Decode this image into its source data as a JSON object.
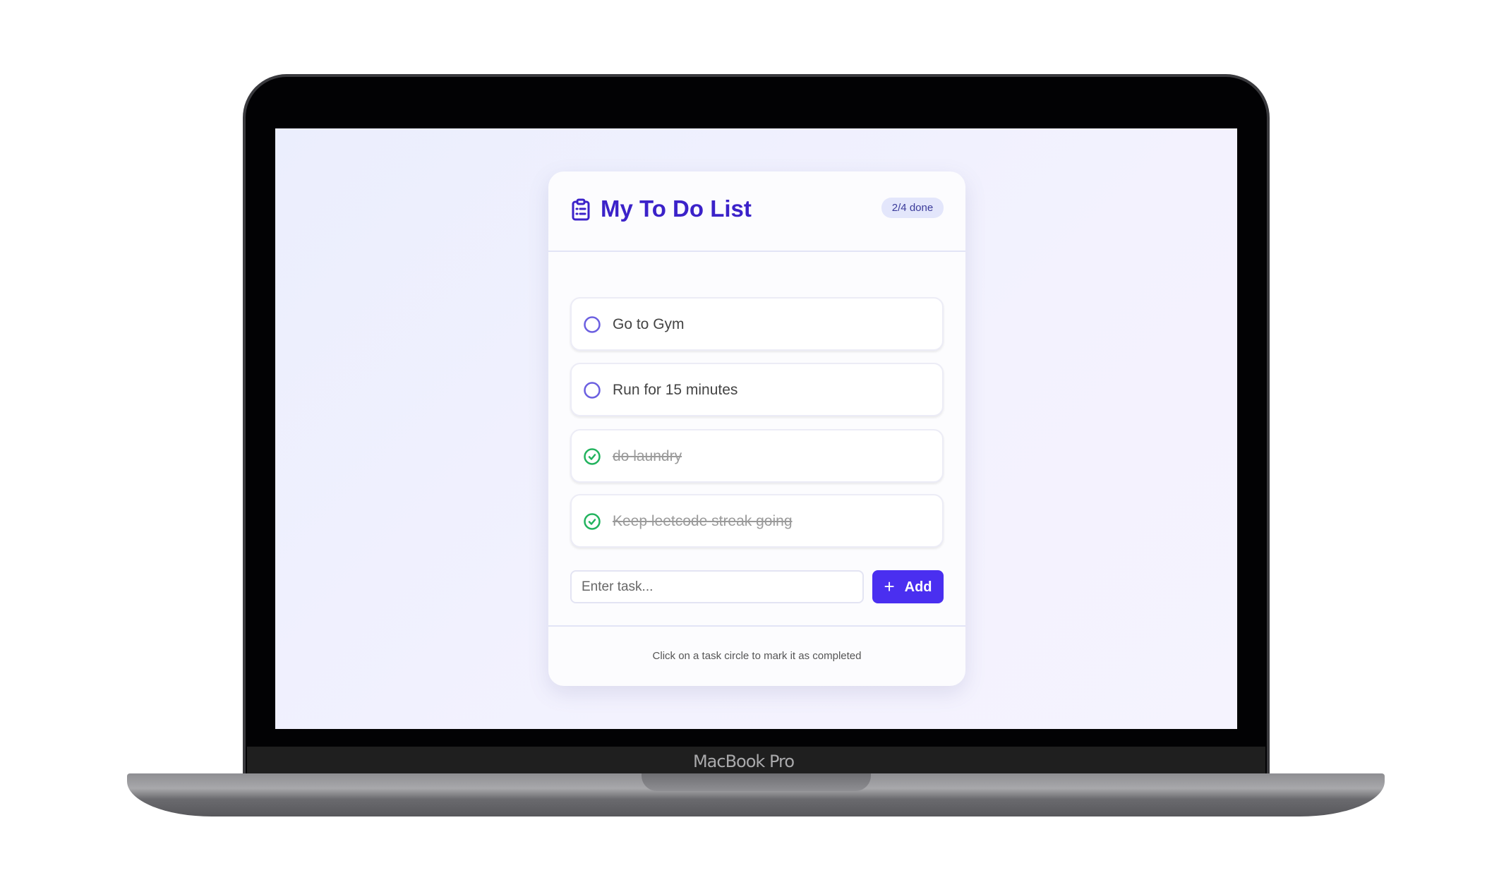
{
  "device": {
    "brand_label": "MacBook Pro"
  },
  "header": {
    "title": "My To Do List",
    "icon": "clipboard-list-icon",
    "progress_badge": "2/4 done"
  },
  "tasks": [
    {
      "label": "Go to Gym",
      "completed": false
    },
    {
      "label": "Run for 15 minutes",
      "completed": false
    },
    {
      "label": "do laundry",
      "completed": true
    },
    {
      "label": "Keep leetcode streak going",
      "completed": true
    }
  ],
  "new_task": {
    "placeholder": "Enter task...",
    "value": "",
    "add_label": "Add",
    "add_icon": "plus-icon"
  },
  "footer": {
    "hint": "Click on a task circle to mark it as completed"
  },
  "colors": {
    "accent": "#4a2ff0",
    "title": "#3b22c9",
    "done": "#22b35e",
    "pending": "#6b5fe0"
  }
}
